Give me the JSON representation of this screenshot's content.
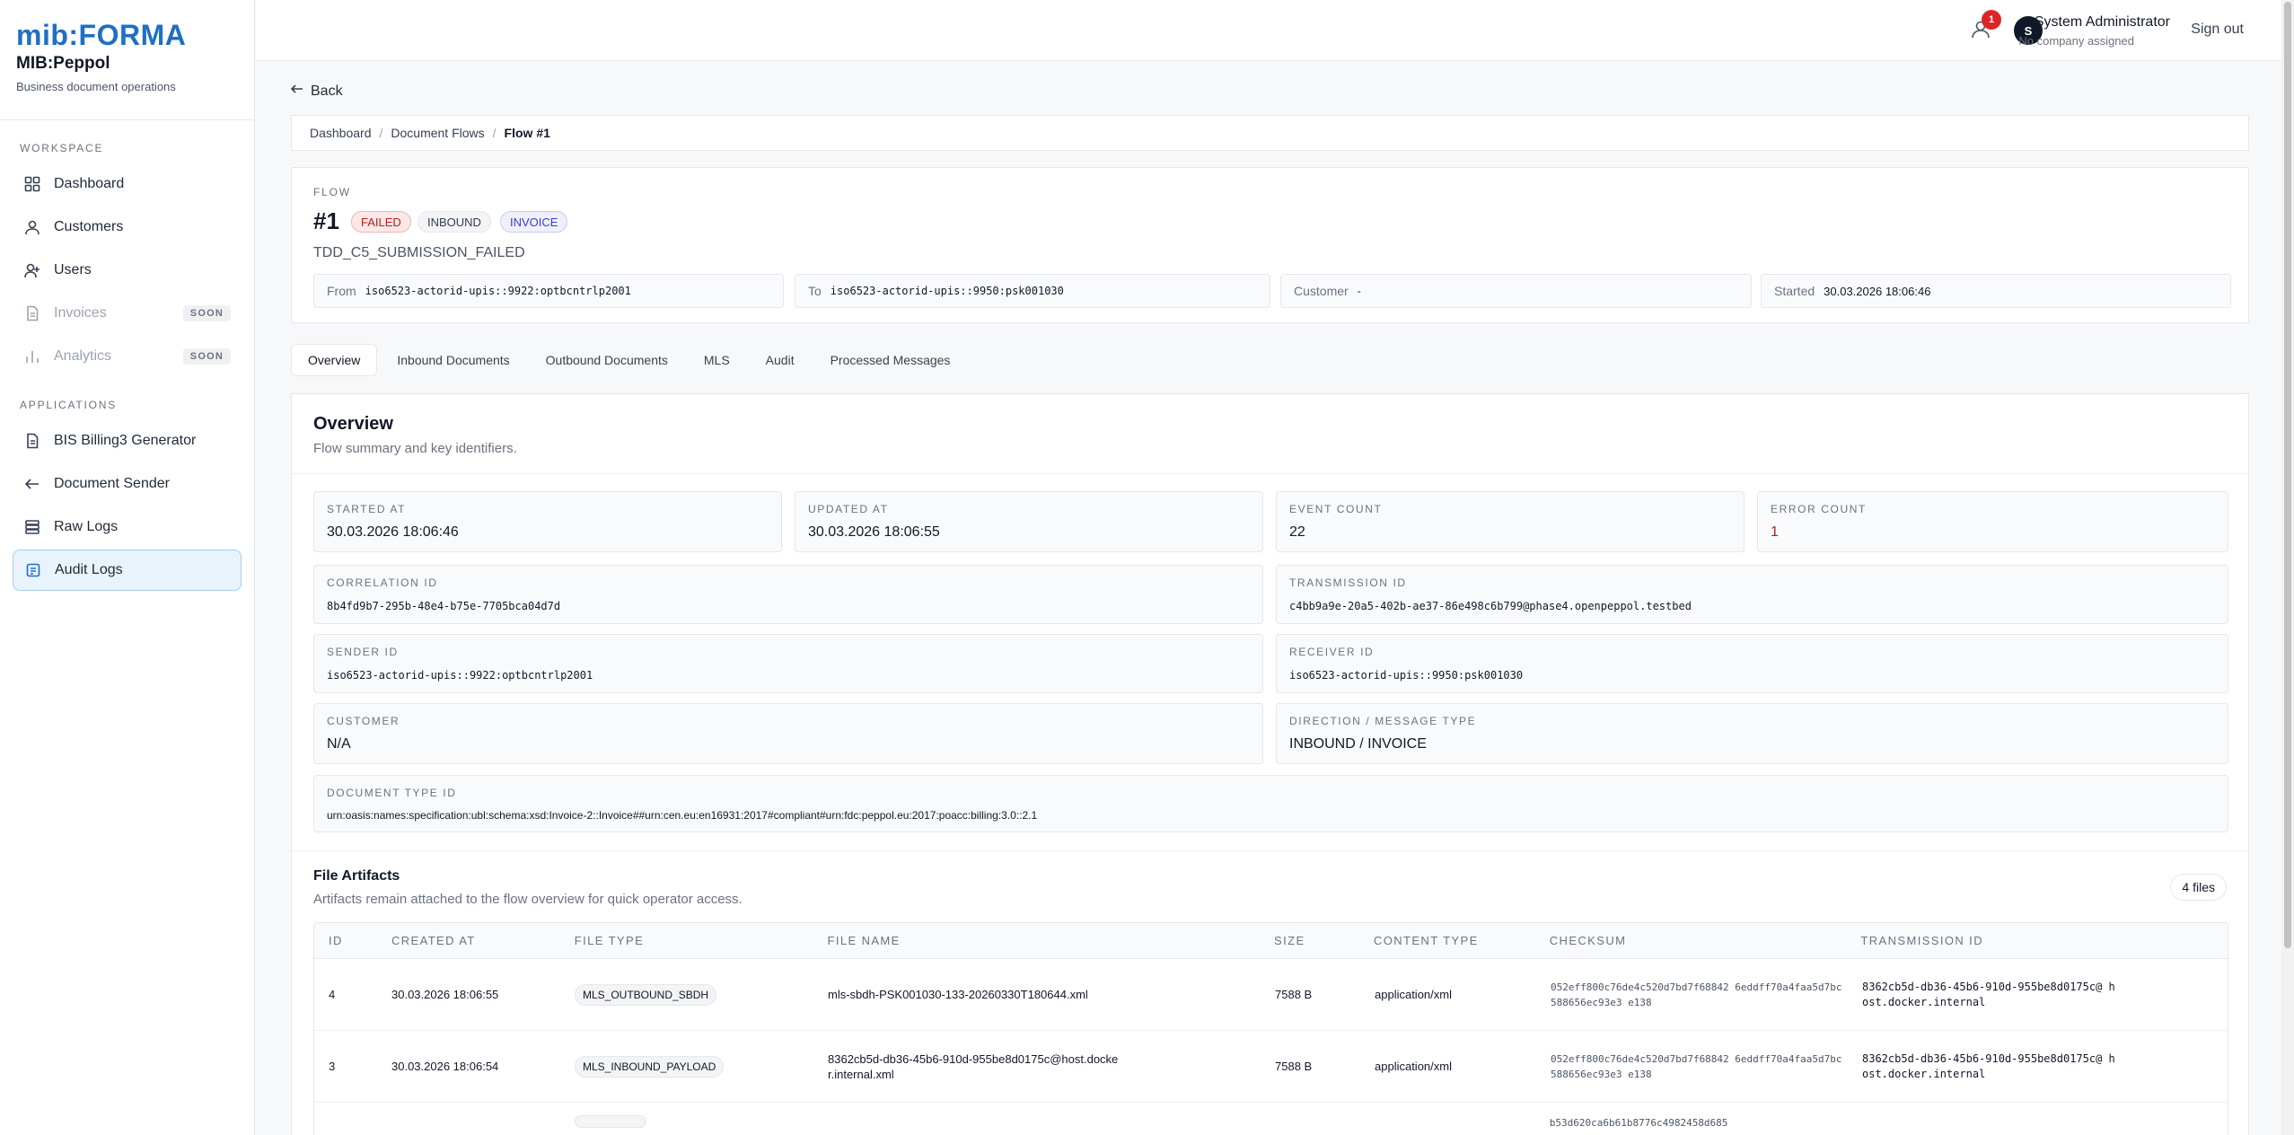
{
  "brand": {
    "logo": "mib:FORMA",
    "app_name": "MIB:Peppol",
    "app_sub": "Business document operations"
  },
  "sidebar": {
    "workspace_label": "WORKSPACE",
    "workspace": [
      {
        "label": "Dashboard",
        "icon": "grid-icon"
      },
      {
        "label": "Customers",
        "icon": "user-icon"
      },
      {
        "label": "Users",
        "icon": "user-plus-icon"
      },
      {
        "label": "Invoices",
        "icon": "document-icon",
        "badge": "SOON"
      },
      {
        "label": "Analytics",
        "icon": "bar-chart-icon",
        "badge": "SOON"
      }
    ],
    "applications_label": "APPLICATIONS",
    "applications": [
      {
        "label": "BIS Billing3 Generator",
        "icon": "document-icon"
      },
      {
        "label": "Document Sender",
        "icon": "arrow-left-icon"
      },
      {
        "label": "Raw Logs",
        "icon": "server-icon"
      },
      {
        "label": "Audit Logs",
        "icon": "log-icon",
        "active": true
      }
    ]
  },
  "topbar": {
    "notification_count": "1",
    "avatar_initial": "S",
    "user_name": "System Administrator",
    "user_sub": "No company assigned",
    "signout": "Sign out"
  },
  "page": {
    "back": "Back",
    "breadcrumbs": [
      "Dashboard",
      "Document Flows",
      "Flow #1"
    ],
    "flow": {
      "label": "FLOW",
      "number": "#1",
      "badges": [
        "FAILED",
        "INBOUND",
        "INVOICE"
      ],
      "code": "TDD_C5_SUBMISSION_FAILED",
      "from_label": "From",
      "from": "iso6523-actorid-upis::9922:optbcntrlp2001",
      "to_label": "To",
      "to": "iso6523-actorid-upis::9950:psk001030",
      "customer_label": "Customer",
      "customer": "-",
      "started_label": "Started",
      "started": "30.03.2026 18:06:46"
    },
    "tabs": [
      "Overview",
      "Inbound Documents",
      "Outbound Documents",
      "MLS",
      "Audit",
      "Processed Messages"
    ],
    "overview": {
      "title": "Overview",
      "subtitle": "Flow summary and key identifiers.",
      "started_at_label": "STARTED AT",
      "started_at": "30.03.2026 18:06:46",
      "updated_at_label": "UPDATED AT",
      "updated_at": "30.03.2026 18:06:55",
      "event_count_label": "EVENT COUNT",
      "event_count": "22",
      "error_count_label": "ERROR COUNT",
      "error_count": "1",
      "correlation_label": "CORRELATION ID",
      "correlation": "8b4fd9b7-295b-48e4-b75e-7705bca04d7d",
      "transmission_label": "TRANSMISSION ID",
      "transmission": "c4bb9a9e-20a5-402b-ae37-86e498c6b799@phase4.openpeppol.testbed",
      "sender_label": "SENDER ID",
      "sender": "iso6523-actorid-upis::9922:optbcntrlp2001",
      "receiver_label": "RECEIVER ID",
      "receiver": "iso6523-actorid-upis::9950:psk001030",
      "customer_label": "CUSTOMER",
      "customer": "N/A",
      "direction_label": "DIRECTION / MESSAGE TYPE",
      "direction": "INBOUND / INVOICE",
      "doctype_label": "DOCUMENT TYPE ID",
      "doctype": "urn:oasis:names:specification:ubl:schema:xsd:Invoice-2::Invoice##urn:cen.eu:en16931:2017#compliant#urn:fdc:peppol.eu:2017:poacc:billing:3.0::2.1"
    },
    "artifacts": {
      "title": "File Artifacts",
      "subtitle": "Artifacts remain attached to the flow overview for quick operator access.",
      "count": "4  files",
      "columns": [
        "ID",
        "CREATED AT",
        "FILE TYPE",
        "FILE NAME",
        "SIZE",
        "CONTENT TYPE",
        "CHECKSUM",
        "TRANSMISSION ID"
      ],
      "rows": [
        {
          "id": "4",
          "created": "30.03.2026 18:06:55",
          "type": "MLS_OUTBOUND_SBDH",
          "name": "mls-sbdh-PSK001030-133-20260330T180644.xml",
          "size": "7588 B",
          "content": "application/xml",
          "checksum": "052eff800c76de4c520d7bd7f68842 6eddff70a4faa5d7bc588656ec93e3 e138",
          "transmission": "8362cb5d-db36-45b6-910d-955be8d0175c@ host.docker.internal"
        },
        {
          "id": "3",
          "created": "30.03.2026 18:06:54",
          "type": "MLS_INBOUND_PAYLOAD",
          "name": "8362cb5d-db36-45b6-910d-955be8d0175c@host.docke r.internal.xml",
          "size": "7588 B",
          "content": "application/xml",
          "checksum": "052eff800c76de4c520d7bd7f68842 6eddff70a4faa5d7bc588656ec93e3 e138",
          "transmission": "8362cb5d-db36-45b6-910d-955be8d0175c@ host.docker.internal"
        },
        {
          "id": "",
          "created": "",
          "type": "",
          "name": "",
          "size": "",
          "content": "",
          "checksum": "b53d620ca6b61b8776c4982458d685",
          "transmission": ""
        }
      ]
    }
  }
}
